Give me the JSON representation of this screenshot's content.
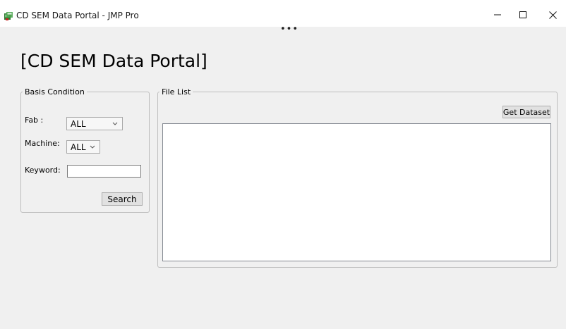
{
  "window": {
    "title": "CD SEM Data Portal - JMP Pro",
    "overflow_indicator": "•••"
  },
  "page": {
    "title": "[CD SEM Data Portal]"
  },
  "basis": {
    "legend": "Basis Condition",
    "fab_label": "Fab :",
    "fab_value": "ALL",
    "machine_label": "Machine:",
    "machine_value": "ALL",
    "keyword_label": "Keyword:",
    "keyword_value": "",
    "search_label": "Search"
  },
  "file_list": {
    "legend": "File List",
    "get_dataset_label": "Get Dataset",
    "items": []
  },
  "icons": {
    "app": "jmp-app-icon",
    "minimize": "minimize-icon",
    "maximize": "maximize-icon",
    "close": "close-icon",
    "dropdown": "chevron-down-icon"
  }
}
